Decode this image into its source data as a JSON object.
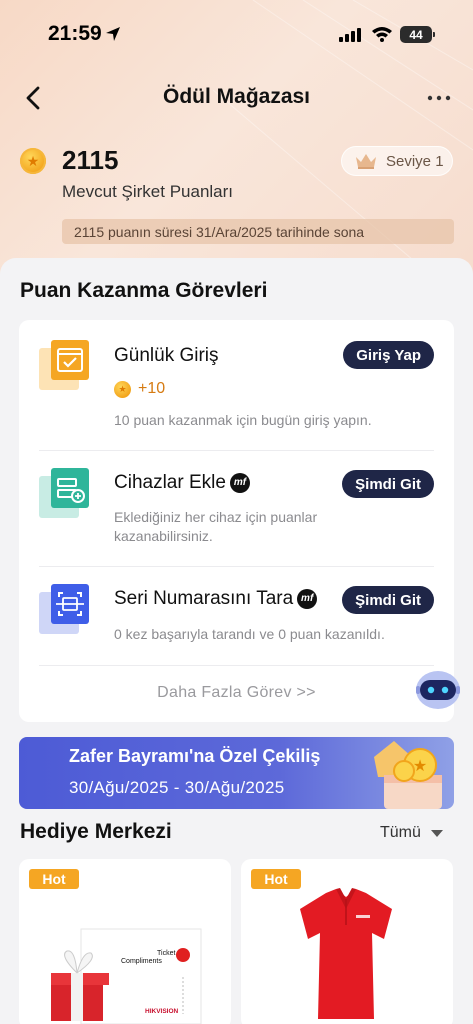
{
  "status_bar": {
    "time": "21:59",
    "battery": "44"
  },
  "header": {
    "title": "Ödül Mağazası"
  },
  "points": {
    "value": "2115",
    "label": "Mevcut Şirket Puanları",
    "level": "Seviye 1",
    "expiry_notice": "2115 puanın süresi 31/Ara/2025 tarihinde sona"
  },
  "tasks_section": {
    "title": "Puan Kazanma Görevleri",
    "tasks": [
      {
        "title": "Günlük Giriş",
        "button": "Giriş Yap",
        "reward": "+10",
        "description": "10 puan kazanmak için bugün giriş yapın."
      },
      {
        "title": "Cihazlar Ekle",
        "button": "Şimdi Git",
        "description": "Eklediğiniz her cihaz için puanlar kazanabilirsiniz."
      },
      {
        "title": "Seri Numarasını Tara",
        "button": "Şimdi Git",
        "description": "0 kez başarıyla tarandı ve 0 puan kazanıldı."
      }
    ],
    "more": "Daha Fazla Görev >>"
  },
  "banner": {
    "title": "Zafer Bayramı'na Özel Çekiliş",
    "dates": "30/Ağu/2025 - 30/Ağu/2025"
  },
  "gift_center": {
    "title": "Hediye Merkezi",
    "filter": "Tümü",
    "products": [
      {
        "tag": "Hot",
        "art_text": [
          "Ticket",
          "Compliments",
          "HIKVISION"
        ]
      },
      {
        "tag": "Hot"
      }
    ]
  },
  "colors": {
    "accent_dark": "#1f2647",
    "reward_orange": "#d67b12",
    "hot_tag": "#f5a623",
    "banner_blue": "#4d5bd6"
  }
}
